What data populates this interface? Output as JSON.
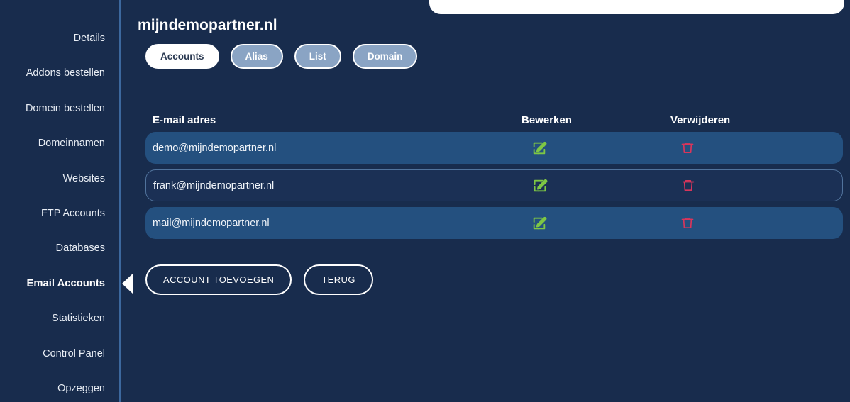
{
  "sidebar": {
    "items": [
      {
        "label": "Details",
        "active": false
      },
      {
        "label": "Addons bestellen",
        "active": false
      },
      {
        "label": "Domein bestellen",
        "active": false
      },
      {
        "label": "Domeinnamen",
        "active": false
      },
      {
        "label": "Websites",
        "active": false
      },
      {
        "label": "FTP Accounts",
        "active": false
      },
      {
        "label": "Databases",
        "active": false
      },
      {
        "label": "Email Accounts",
        "active": true
      },
      {
        "label": "Statistieken",
        "active": false
      },
      {
        "label": "Control Panel",
        "active": false
      },
      {
        "label": "Opzeggen",
        "active": false
      }
    ]
  },
  "header": {
    "title": "mijndemopartner.nl"
  },
  "tabs": [
    {
      "label": "Accounts",
      "active": true
    },
    {
      "label": "Alias",
      "active": false
    },
    {
      "label": "List",
      "active": false
    },
    {
      "label": "Domain",
      "active": false
    }
  ],
  "table": {
    "columns": {
      "email": "E-mail adres",
      "edit": "Bewerken",
      "delete": "Verwijderen"
    },
    "rows": [
      {
        "email": "demo@mijndemopartner.nl"
      },
      {
        "email": "frank@mijndemopartner.nl"
      },
      {
        "email": "mail@mijndemopartner.nl"
      }
    ]
  },
  "actions": {
    "add_label": "ACCOUNT TOEVOEGEN",
    "back_label": "TERUG"
  },
  "icons": {
    "edit": "edit-square-icon",
    "delete": "trash-icon"
  },
  "colors": {
    "background": "#182c4d",
    "row_odd": "#24507f",
    "row_even": "#1b3055",
    "accent_white": "#ffffff",
    "tab_inactive": "#8aa4c4",
    "edit_icon": "#7ec744",
    "delete_icon": "#d9355b",
    "divider": "#3c689e"
  }
}
